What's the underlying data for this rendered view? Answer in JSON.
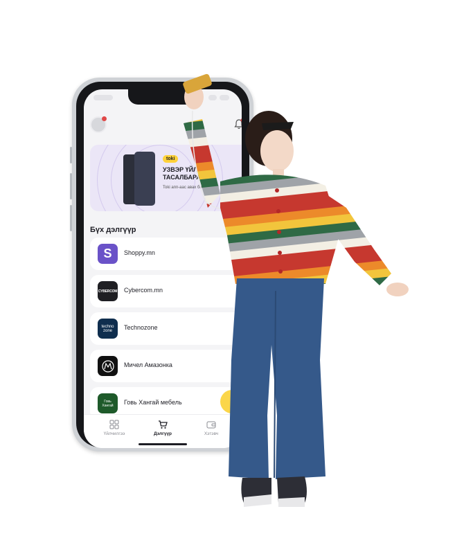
{
  "app": {
    "banner": {
      "logo_text": "toki",
      "title": "УЗВЭР ҮЙЛЧ\nТАСАЛБАРАА",
      "subtitle": "Toki апп-аас авах боломжтой"
    },
    "section_title": "Бүх дэлгүүр",
    "stores": [
      {
        "name": "Shoppy.mn",
        "logo_text": "S",
        "logo_bg": "#6a52c8",
        "logo_color": "#ffffff"
      },
      {
        "name": "Cybercom.mn",
        "logo_text": "CYBERCOM",
        "logo_bg": "#1f1f23",
        "logo_color": "#ffffff"
      },
      {
        "name": "Technozone",
        "logo_text": "techno zone",
        "logo_bg": "#0f2e4e",
        "logo_color": "#ffffff"
      },
      {
        "name": "Мичел Амазонка",
        "logo_text": "M",
        "logo_bg": "#111111",
        "logo_color": "#ffffff"
      },
      {
        "name": "Говь Хангай мебель",
        "logo_text": "Говь Хангай",
        "logo_bg": "#1e5a2a",
        "logo_color": "#ffffff"
      }
    ],
    "tabbar": {
      "items": [
        {
          "label": "Үйлчилгээ",
          "icon": "grid-icon",
          "active": false
        },
        {
          "label": "Дэлгүүр",
          "icon": "cart-icon",
          "active": true
        },
        {
          "label": "Хэтэвч",
          "icon": "wallet-icon",
          "active": false
        }
      ]
    },
    "colors": {
      "accent": "#fbd64a",
      "banner_bg": "#ebe6f7",
      "notification": "#e04848"
    }
  }
}
